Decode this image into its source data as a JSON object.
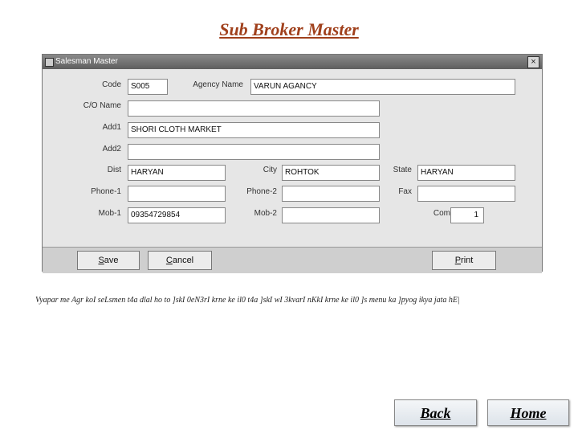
{
  "page": {
    "title": "Sub Broker Master"
  },
  "window": {
    "title": "Salesman Master",
    "close": "×"
  },
  "form": {
    "code": {
      "label": "Code",
      "value": "S005"
    },
    "agency_name": {
      "label": "Agency Name",
      "value": "VARUN AGANCY"
    },
    "co_name": {
      "label": "C/O Name",
      "value": ""
    },
    "add1": {
      "label": "Add1",
      "value": "SHORI CLOTH MARKET"
    },
    "add2": {
      "label": "Add2",
      "value": ""
    },
    "dist": {
      "label": "Dist",
      "value": "HARYAN"
    },
    "city": {
      "label": "City",
      "value": "ROHTOK"
    },
    "state": {
      "label": "State",
      "value": "HARYAN"
    },
    "phone1": {
      "label": "Phone-1",
      "value": ""
    },
    "phone2": {
      "label": "Phone-2",
      "value": ""
    },
    "fax": {
      "label": "Fax",
      "value": ""
    },
    "mob1": {
      "label": "Mob-1",
      "value": "09354729854"
    },
    "mob2": {
      "label": "Mob-2",
      "value": ""
    },
    "comm": {
      "label": "Comm %",
      "value": "1"
    }
  },
  "buttons": {
    "save_u": "S",
    "save_rest": "ave",
    "cancel_u": "C",
    "cancel_rest": "ancel",
    "print_u": "P",
    "print_rest": "rint"
  },
  "note": "Vyapar me Agr koI seLsmen t4a dlal ho to ]skI 0eN3rI krne ke il0 t4a ]skI wI 3kvarI nKkI krne ke il0 ]s menu ka ]pyog ikya jata hE|",
  "nav": {
    "back": "Back",
    "home": "Home"
  }
}
